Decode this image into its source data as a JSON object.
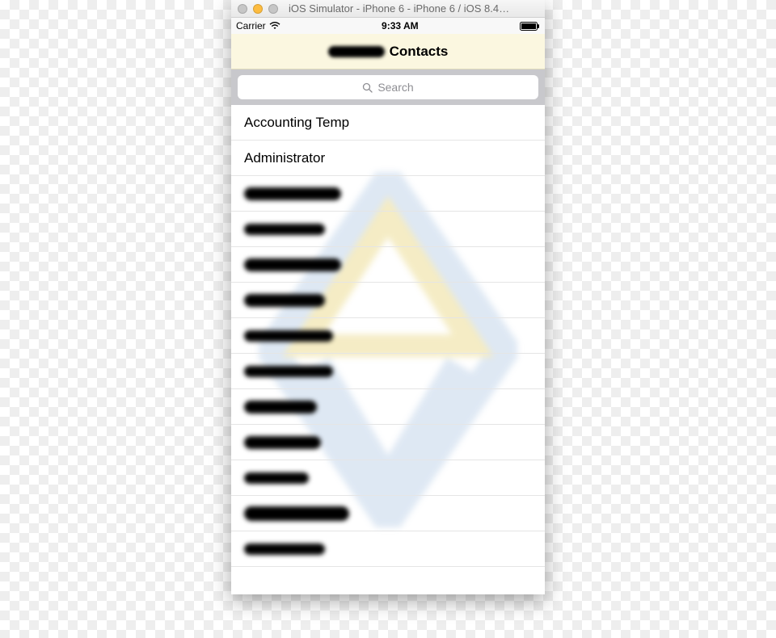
{
  "window": {
    "title": "iOS Simulator - iPhone 6 - iPhone 6 / iOS 8.4…"
  },
  "status_bar": {
    "carrier": "Carrier",
    "time": "9:33 AM"
  },
  "nav": {
    "title_suffix": "Contacts"
  },
  "search": {
    "placeholder": "Search"
  },
  "contacts": [
    {
      "name": "Accounting Temp",
      "redacted": false
    },
    {
      "name": "Administrator",
      "redacted": false
    },
    {
      "name": "",
      "redacted": true,
      "redact_w": 120,
      "redact_h": 16
    },
    {
      "name": "",
      "redacted": true,
      "redact_w": 100,
      "redact_h": 14
    },
    {
      "name": "",
      "redacted": true,
      "redact_w": 120,
      "redact_h": 16
    },
    {
      "name": "",
      "redacted": true,
      "redact_w": 100,
      "redact_h": 16
    },
    {
      "name": "",
      "redacted": true,
      "redact_w": 110,
      "redact_h": 14
    },
    {
      "name": "",
      "redacted": true,
      "redact_w": 110,
      "redact_h": 14
    },
    {
      "name": "",
      "redacted": true,
      "redact_w": 90,
      "redact_h": 16
    },
    {
      "name": "",
      "redacted": true,
      "redact_w": 95,
      "redact_h": 16
    },
    {
      "name": "",
      "redacted": true,
      "redact_w": 80,
      "redact_h": 14
    },
    {
      "name": "",
      "redacted": true,
      "redact_w": 130,
      "redact_h": 18
    },
    {
      "name": "",
      "redacted": true,
      "redact_w": 100,
      "redact_h": 14
    }
  ]
}
